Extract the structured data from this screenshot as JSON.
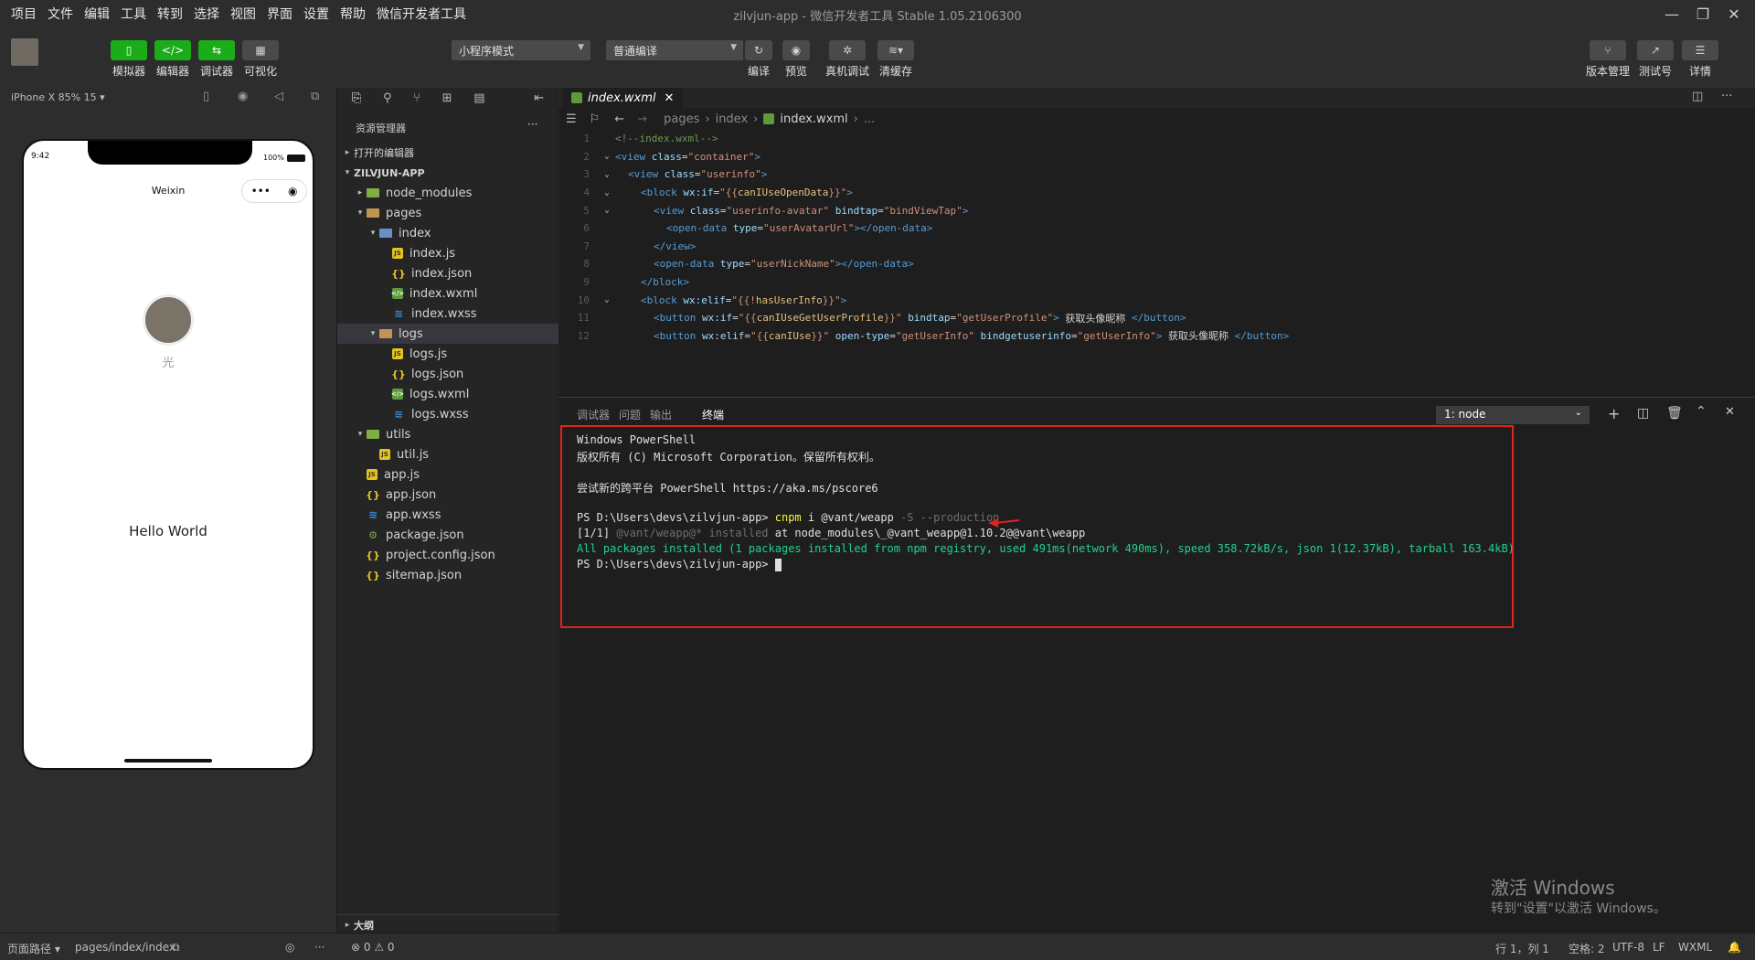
{
  "window": {
    "title": "zilvjun-app - 微信开发者工具 Stable 1.05.2106300",
    "menu": [
      "项目",
      "文件",
      "编辑",
      "工具",
      "转到",
      "选择",
      "视图",
      "界面",
      "设置",
      "帮助",
      "微信开发者工具"
    ]
  },
  "toolbar": {
    "simulator": "模拟器",
    "editor": "编辑器",
    "debugger": "调试器",
    "visual": "可视化",
    "mode_select": "小程序模式",
    "compile_select": "普通编译",
    "compile": "编译",
    "preview": "预览",
    "real_debug": "真机调试",
    "clear_cache": "清缓存",
    "version": "版本管理",
    "test_account": "测试号",
    "details": "详情"
  },
  "simulator": {
    "device": "iPhone X 85% 15",
    "time": "9:42",
    "battery": "100%",
    "nav_title": "Weixin",
    "nickname": "光",
    "hello": "Hello World"
  },
  "explorer": {
    "title": "资源管理器",
    "more": "···",
    "open_editors": "打开的编辑器",
    "project": "ZILVJUN-APP",
    "outline": "大纲",
    "tree": [
      {
        "name": "node_modules",
        "type": "folder-green",
        "depth": 1,
        "twisty": "▸"
      },
      {
        "name": "pages",
        "type": "folder",
        "depth": 1,
        "twisty": "▾"
      },
      {
        "name": "index",
        "type": "folder-blue",
        "depth": 2,
        "twisty": "▾"
      },
      {
        "name": "index.js",
        "type": "js",
        "depth": 3
      },
      {
        "name": "index.json",
        "type": "json",
        "depth": 3
      },
      {
        "name": "index.wxml",
        "type": "wxml",
        "depth": 3
      },
      {
        "name": "index.wxss",
        "type": "wxss",
        "depth": 3
      },
      {
        "name": "logs",
        "type": "folder",
        "depth": 2,
        "twisty": "▾",
        "selected": true
      },
      {
        "name": "logs.js",
        "type": "js",
        "depth": 3
      },
      {
        "name": "logs.json",
        "type": "json",
        "depth": 3
      },
      {
        "name": "logs.wxml",
        "type": "wxml",
        "depth": 3
      },
      {
        "name": "logs.wxss",
        "type": "wxss",
        "depth": 3
      },
      {
        "name": "utils",
        "type": "folder-green",
        "depth": 1,
        "twisty": "▾"
      },
      {
        "name": "util.js",
        "type": "js",
        "depth": 2
      },
      {
        "name": "app.js",
        "type": "js",
        "depth": 1
      },
      {
        "name": "app.json",
        "type": "json",
        "depth": 1
      },
      {
        "name": "app.wxss",
        "type": "wxss",
        "depth": 1
      },
      {
        "name": "package.json",
        "type": "json-green",
        "depth": 1
      },
      {
        "name": "project.config.json",
        "type": "json",
        "depth": 1
      },
      {
        "name": "sitemap.json",
        "type": "json",
        "depth": 1
      }
    ]
  },
  "editor": {
    "tab": "index.wxml",
    "breadcrumb": [
      "pages",
      "index",
      "index.wxml",
      "..."
    ],
    "lines": [
      {
        "n": "1",
        "fold": "",
        "html": [
          [
            "cm",
            "<!--index.wxml-->"
          ]
        ],
        "indent": 0
      },
      {
        "n": "2",
        "fold": "⌄",
        "html": [
          [
            "tg",
            "<view "
          ],
          [
            "at",
            "class"
          ],
          [
            "tx",
            "="
          ],
          [
            "st",
            "\"container\""
          ],
          [
            "tg",
            ">"
          ]
        ],
        "indent": 0
      },
      {
        "n": "3",
        "fold": "⌄",
        "html": [
          [
            "tg",
            "<view "
          ],
          [
            "at",
            "class"
          ],
          [
            "tx",
            "="
          ],
          [
            "st",
            "\"userinfo\""
          ],
          [
            "tg",
            ">"
          ]
        ],
        "indent": 1
      },
      {
        "n": "4",
        "fold": "⌄",
        "html": [
          [
            "tg",
            "<block "
          ],
          [
            "at",
            "wx:if"
          ],
          [
            "tx",
            "="
          ],
          [
            "st",
            "\"{{"
          ],
          [
            "ex",
            "canIUseOpenData"
          ],
          [
            "st",
            "}}\""
          ],
          [
            "tg",
            ">"
          ]
        ],
        "indent": 2
      },
      {
        "n": "5",
        "fold": "⌄",
        "html": [
          [
            "tg",
            "<view "
          ],
          [
            "at",
            "class"
          ],
          [
            "tx",
            "="
          ],
          [
            "st",
            "\"userinfo-avatar\" "
          ],
          [
            "at",
            "bindtap"
          ],
          [
            "tx",
            "="
          ],
          [
            "st",
            "\"bindViewTap\""
          ],
          [
            "tg",
            ">"
          ]
        ],
        "indent": 3
      },
      {
        "n": "6",
        "fold": "",
        "html": [
          [
            "tg",
            "<open-data "
          ],
          [
            "at",
            "type"
          ],
          [
            "tx",
            "="
          ],
          [
            "st",
            "\"userAvatarUrl\""
          ],
          [
            "tg",
            "></open-data>"
          ]
        ],
        "indent": 4
      },
      {
        "n": "7",
        "fold": "",
        "html": [
          [
            "tg",
            "</view>"
          ]
        ],
        "indent": 3
      },
      {
        "n": "8",
        "fold": "",
        "html": [
          [
            "tg",
            "<open-data "
          ],
          [
            "at",
            "type"
          ],
          [
            "tx",
            "="
          ],
          [
            "st",
            "\"userNickName\""
          ],
          [
            "tg",
            "></open-data>"
          ]
        ],
        "indent": 3
      },
      {
        "n": "9",
        "fold": "",
        "html": [
          [
            "tg",
            "</block>"
          ]
        ],
        "indent": 2
      },
      {
        "n": "10",
        "fold": "⌄",
        "html": [
          [
            "tg",
            "<block "
          ],
          [
            "at",
            "wx:elif"
          ],
          [
            "tx",
            "="
          ],
          [
            "st",
            "\"{{!"
          ],
          [
            "ex",
            "hasUserInfo"
          ],
          [
            "st",
            "}}\""
          ],
          [
            "tg",
            ">"
          ]
        ],
        "indent": 2
      },
      {
        "n": "11",
        "fold": "",
        "html": [
          [
            "tg",
            "<button "
          ],
          [
            "at",
            "wx:if"
          ],
          [
            "tx",
            "="
          ],
          [
            "st",
            "\"{{"
          ],
          [
            "ex",
            "canIUseGetUserProfile"
          ],
          [
            "st",
            "}}\" "
          ],
          [
            "at",
            "bindtap"
          ],
          [
            "tx",
            "="
          ],
          [
            "st",
            "\"getUserProfile\""
          ],
          [
            "tg",
            "> "
          ],
          [
            "tx",
            "获取头像昵称 "
          ],
          [
            "tg",
            "</button>"
          ]
        ],
        "indent": 3
      },
      {
        "n": "12",
        "fold": "",
        "html": [
          [
            "tg",
            "<button "
          ],
          [
            "at",
            "wx:elif"
          ],
          [
            "tx",
            "="
          ],
          [
            "st",
            "\"{{"
          ],
          [
            "ex",
            "canIUse"
          ],
          [
            "st",
            "}}\" "
          ],
          [
            "at",
            "open-type"
          ],
          [
            "tx",
            "="
          ],
          [
            "st",
            "\"getUserInfo\" "
          ],
          [
            "at",
            "bindgetuserinfo"
          ],
          [
            "tx",
            "="
          ],
          [
            "st",
            "\"getUserInfo\""
          ],
          [
            "tg",
            "> "
          ],
          [
            "tx",
            "获取头像昵称 "
          ],
          [
            "tg",
            "</button>"
          ]
        ],
        "indent": 3
      }
    ]
  },
  "panel": {
    "tabs": [
      "调试器",
      "问题",
      "输出",
      "终端"
    ],
    "terminal_select": "1: node",
    "terminal": {
      "l1": "Windows PowerShell",
      "l2": "版权所有 (C) Microsoft Corporation。保留所有权利。",
      "l3": "尝试新的跨平台 PowerShell https://aka.ms/pscore6",
      "prompt": "PS D:\\Users\\devs\\zilvjun-app> ",
      "cmd": "cnpm",
      "cmd_args": " i @vant/weapp ",
      "cmd_flags": "-S --production",
      "r_prefix": "[1/1] ",
      "r_pkg": "@vant/weapp@* installed",
      "r_rest": " at node_modules\\_@vant_weapp@1.10.2@@vant\\weapp",
      "summary": "All packages installed (1 packages installed from npm registry, used 491ms(network 490ms), speed 358.72kB/s, json 1(12.37kB), tarball 163.4kB)",
      "prompt2": "PS D:\\Users\\devs\\zilvjun-app> "
    }
  },
  "watermark": {
    "l1": "激活 Windows",
    "l2": "转到\"设置\"以激活 Windows。"
  },
  "status": {
    "page_path_label": "页面路径",
    "page_path": "pages/index/index",
    "problems": "⊗ 0 ⚠ 0",
    "cursor": "行 1，列 1",
    "spaces": "空格: 2",
    "encoding": "UTF-8",
    "eol": "LF",
    "lang": "WXML"
  },
  "colors": {
    "accent": "#1aad19",
    "highlight": "#e0231c",
    "term_green": "#23d18b"
  }
}
